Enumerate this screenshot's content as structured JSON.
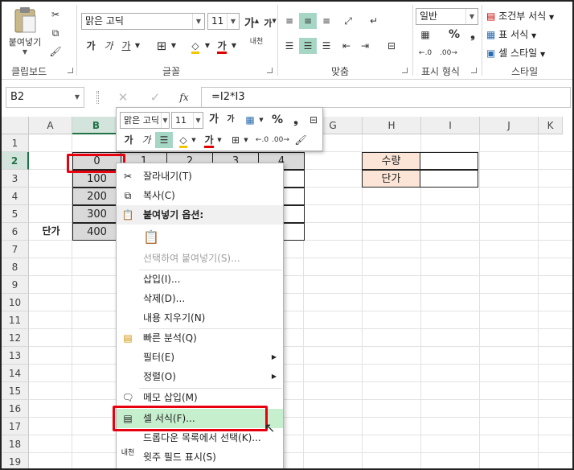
{
  "ribbon": {
    "clipboard": {
      "paste_label": "붙여넣기",
      "group_label": "클립보드"
    },
    "font": {
      "font_name": "맑은 고딕",
      "font_size": "11",
      "bold": "가",
      "italic": "가",
      "underline": "가",
      "font_color_glyph": "가",
      "phonetic_glyph": "내천",
      "group_label": "글꼴"
    },
    "alignment": {
      "group_label": "맞춤"
    },
    "number": {
      "format": "일반",
      "percent": "%",
      "comma": "❟",
      "group_label": "표시 형식"
    },
    "styles": {
      "conditional": "조건부 서식",
      "table": "표 서식",
      "cell": "셀 스타일",
      "group_label": "스타일"
    }
  },
  "formula_bar": {
    "name_box": "B2",
    "formula": "=I2*I3"
  },
  "grid": {
    "columns": [
      "A",
      "B",
      "C",
      "D",
      "E",
      "F",
      "G",
      "H",
      "I",
      "J",
      "K"
    ],
    "rows": [
      "1",
      "2",
      "3",
      "4",
      "5",
      "6",
      "7",
      "8",
      "9",
      "10",
      "11",
      "12",
      "13",
      "14",
      "15",
      "16",
      "17",
      "18",
      "19"
    ],
    "b_values": [
      "0",
      "100",
      "200",
      "300",
      "400"
    ],
    "c_headers": [
      "1",
      "2",
      "3",
      "4"
    ],
    "a6": "단가",
    "h2": "수량",
    "h3": "단가"
  },
  "mini_toolbar": {
    "font_name": "맑은 고딕",
    "font_size": "11",
    "percent": "%",
    "comma": "❟",
    "bold": "가",
    "italic": "가",
    "font_color": "가"
  },
  "context_menu": {
    "cut": "잘라내기(T)",
    "copy": "복사(C)",
    "paste_options": "붙여넣기 옵션:",
    "paste_special": "선택하여 붙여넣기(S)...",
    "insert": "삽입(I)...",
    "delete": "삭제(D)...",
    "clear": "내용 지우기(N)",
    "quick_analysis": "빠른 분석(Q)",
    "filter": "필터(E)",
    "sort": "정렬(O)",
    "insert_comment": "메모 삽입(M)",
    "format_cells": "셀 서식(F)...",
    "pick_list": "드롭다운 목록에서 선택(K)...",
    "phonetic": "윗주 필드 표시(S)"
  }
}
